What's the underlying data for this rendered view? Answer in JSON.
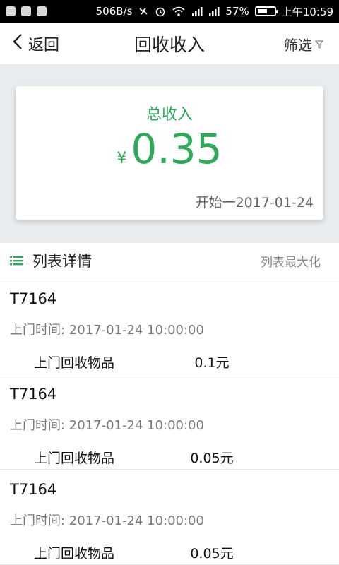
{
  "status_bar": {
    "net_speed": "506B/s",
    "battery_percent": "57%",
    "battery_level": 0.57,
    "time": "上午10:59",
    "left_icons": [
      "notification-icon",
      "notification-icon",
      "notification-icon"
    ]
  },
  "header": {
    "back_label": "返回",
    "title": "回收收入",
    "filter_label": "筛选"
  },
  "summary": {
    "label": "总收入",
    "currency": "¥",
    "amount": "0.35",
    "date_range": "开始一2017-01-24"
  },
  "list": {
    "title": "列表详情",
    "maximize_label": "列表最大化",
    "records": [
      {
        "id": "T7164",
        "time": "上门时间: 2017-01-24 10:00:00",
        "item": "上门回收物品",
        "amount": "0.1元"
      },
      {
        "id": "T7164",
        "time": "上门时间: 2017-01-24 10:00:00",
        "item": "上门回收物品",
        "amount": "0.05元"
      },
      {
        "id": "T7164",
        "time": "上门时间: 2017-01-24 10:00:00",
        "item": "上门回收物品",
        "amount": "0.05元"
      }
    ]
  },
  "colors": {
    "accent": "#2eaa5a",
    "status_bar": "#000000",
    "summary_background": "#e9ecee"
  }
}
